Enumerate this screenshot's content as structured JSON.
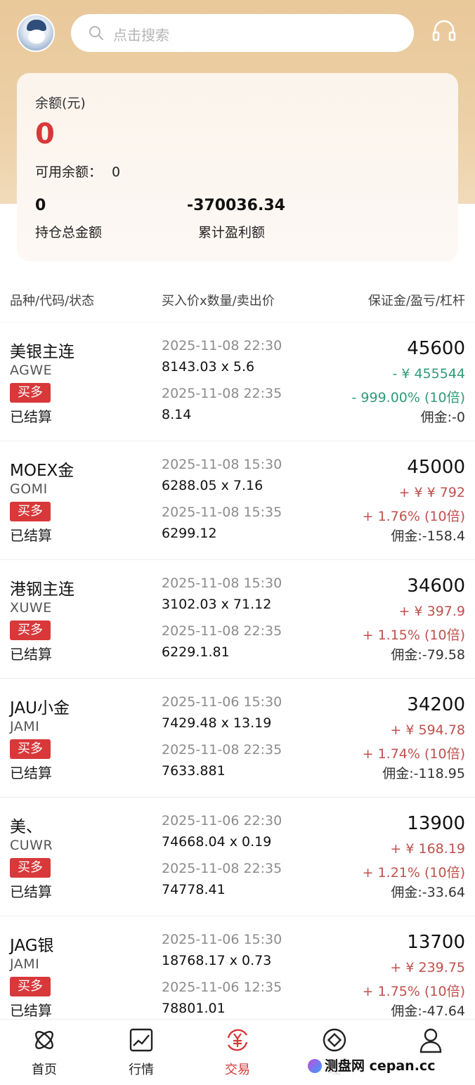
{
  "header": {
    "search_placeholder": "点击搜索"
  },
  "balance": {
    "label": "余额(元)",
    "value": "0",
    "available_label": "可用余额：",
    "available_value": "0",
    "stat1_value": "0",
    "stat1_label": "持仓总金额",
    "stat2_value": "-370036.34",
    "stat2_label": "累计盈利额"
  },
  "columns": {
    "c1": "品种/代码/状态",
    "c2": "买入价x数量/卖出价",
    "c3": "保证金/盈亏/杠杆"
  },
  "orders": [
    {
      "name": "美银主连",
      "code": "AGWE",
      "side": "买多",
      "status": "已结算",
      "open_time": "2025-11-08 22:30",
      "buy": "8143.03 x 5.6",
      "close_time": "2025-11-08 22:35",
      "sell": "8.14",
      "margin": "45600",
      "pnl": "- ¥ 455544",
      "pct": "- 999.00% (10倍)",
      "commission": "佣金:-0",
      "trend": "down"
    },
    {
      "name": "MOEX金",
      "code": "GOMI",
      "side": "买多",
      "status": "已结算",
      "open_time": "2025-11-08 15:30",
      "buy": "6288.05 x 7.16",
      "close_time": "2025-11-08 15:35",
      "sell": "6299.12",
      "margin": "45000",
      "pnl": "+ ¥ ¥ 792",
      "pct": "+ 1.76% (10倍)",
      "commission": "佣金:-158.4",
      "trend": "up"
    },
    {
      "name": "港钢主连",
      "code": "XUWE",
      "side": "买多",
      "status": "已结算",
      "open_time": "2025-11-08 15:30",
      "buy": "3102.03 x 71.12",
      "close_time": "2025-11-08 22:35",
      "sell": "6229.1.81",
      "margin": "34600",
      "pnl": "+ ¥ 397.9",
      "pct": "+ 1.15% (10倍)",
      "commission": "佣金:-79.58",
      "trend": "up"
    },
    {
      "name": "JAU小金",
      "code": "JAMI",
      "side": "买多",
      "status": "已结算",
      "open_time": "2025-11-06 15:30",
      "buy": "7429.48 x 13.19",
      "close_time": "2025-11-08 22:35",
      "sell": "7633.881",
      "margin": "34200",
      "pnl": "+ ¥ 594.78",
      "pct": "+ 1.74% (10倍)",
      "commission": "佣金:-118.95",
      "trend": "up"
    },
    {
      "name": "美、",
      "code": "CUWR",
      "side": "买多",
      "status": "已结算",
      "open_time": "2025-11-06 22:30",
      "buy": "74668.04 x 0.19",
      "close_time": "2025-11-08 22:35",
      "sell": "74778.41",
      "margin": "13900",
      "pnl": "+ ¥ 168.19",
      "pct": "+ 1.21% (10倍)",
      "commission": "佣金:-33.64",
      "trend": "up"
    },
    {
      "name": "JAG银",
      "code": "JAMI",
      "side": "买多",
      "status": "已结算",
      "open_time": "2025-11-06 15:30",
      "buy": "18768.17 x 0.73",
      "close_time": "2025-11-06 12:35",
      "sell": "78801.01",
      "margin": "13700",
      "pnl": "+ ¥ 239.75",
      "pct": "+ 1.75% (10倍)",
      "commission": "佣金:-47.64",
      "trend": "up"
    }
  ],
  "tabs": [
    {
      "label": "首页",
      "icon": "home-icon"
    },
    {
      "label": "行情",
      "icon": "chart-icon"
    },
    {
      "label": "交易",
      "icon": "trade-icon"
    },
    {
      "label": "理",
      "icon": "finance-icon"
    },
    {
      "label": "",
      "icon": "user-icon"
    }
  ],
  "watermark": "测盘网 cepan.cc",
  "colors": {
    "accent": "#d8383a",
    "gain": "#c0504d",
    "loss": "#2e9b78",
    "header_bg": "#e9c89a"
  }
}
